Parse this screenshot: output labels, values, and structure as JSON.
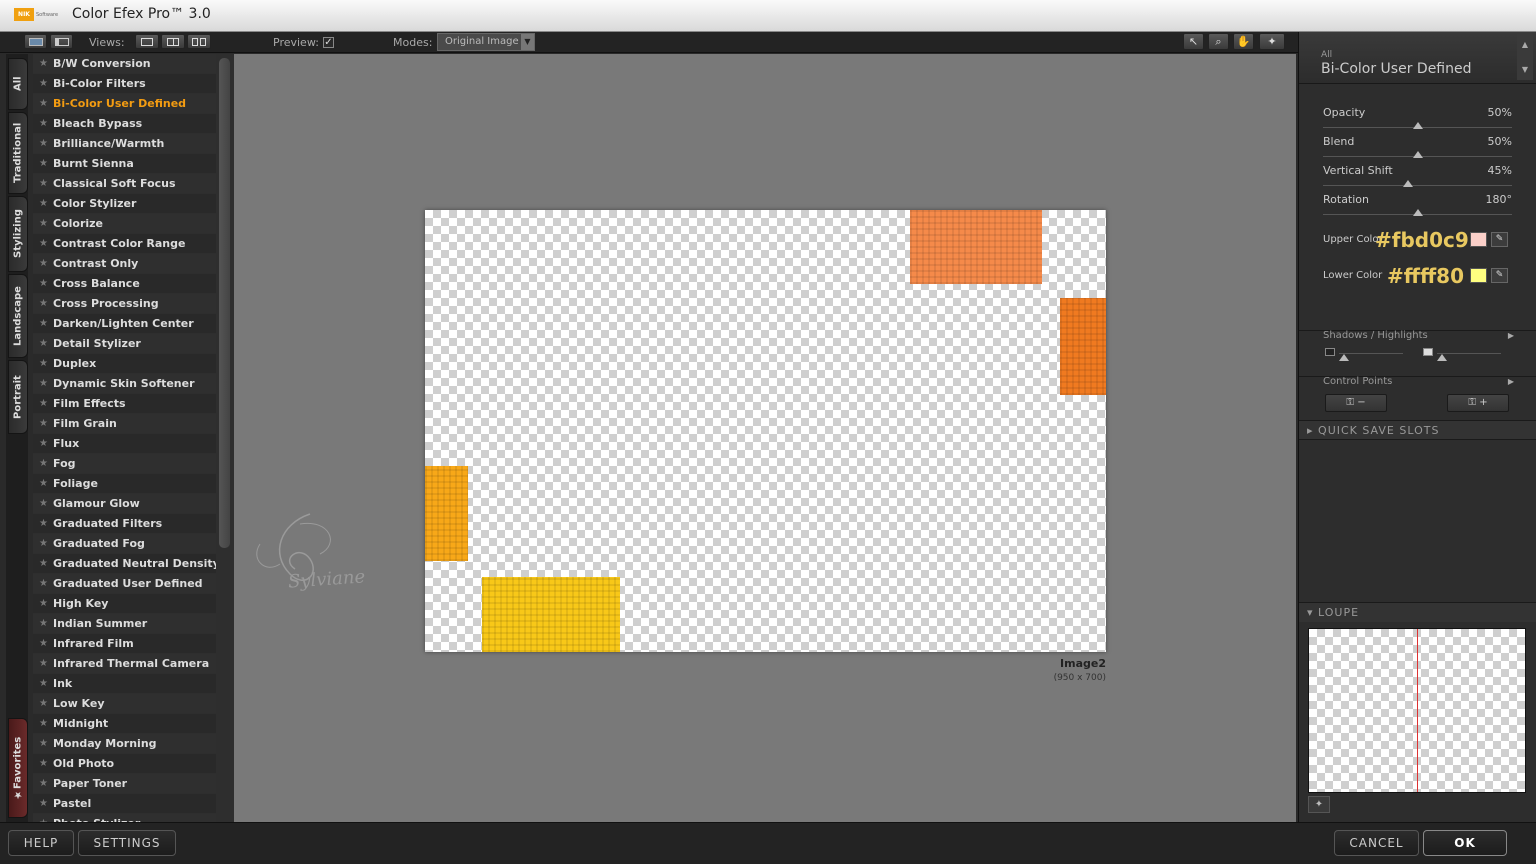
{
  "app": {
    "logo_text": "NIK",
    "logo_sub": "Software",
    "title": "Color Efex Pro™ 3.0"
  },
  "toolbar": {
    "views_label": "Views:",
    "preview_label": "Preview:",
    "preview_checked": true,
    "modes_label": "Modes:",
    "modes_value": "Original Image"
  },
  "side_tabs": [
    "All",
    "Traditional",
    "Stylizing",
    "Landscape",
    "Portrait",
    "Favorites"
  ],
  "filters": [
    "B/W Conversion",
    "Bi-Color Filters",
    "Bi-Color User Defined",
    "Bleach Bypass",
    "Brilliance/Warmth",
    "Burnt Sienna",
    "Classical Soft Focus",
    "Color Stylizer",
    "Colorize",
    "Contrast Color Range",
    "Contrast Only",
    "Cross Balance",
    "Cross Processing",
    "Darken/Lighten Center",
    "Detail Stylizer",
    "Duplex",
    "Dynamic Skin Softener",
    "Film Effects",
    "Film Grain",
    "Flux",
    "Fog",
    "Foliage",
    "Glamour Glow",
    "Graduated Filters",
    "Graduated Fog",
    "Graduated Neutral Density",
    "Graduated User Defined",
    "High Key",
    "Indian Summer",
    "Infrared Film",
    "Infrared Thermal Camera",
    "Ink",
    "Low Key",
    "Midnight",
    "Monday Morning",
    "Old Photo",
    "Paper Toner",
    "Pastel",
    "Photo Stylizer"
  ],
  "selected_filter": "Bi-Color User Defined",
  "image": {
    "name": "Image2",
    "size": "(950 x 700)"
  },
  "watermark_text": "Sylviane",
  "panel": {
    "category": "All",
    "filter_name": "Bi-Color User Defined",
    "sliders": [
      {
        "label": "Opacity",
        "value": "50%",
        "level": 0.5
      },
      {
        "label": "Blend",
        "value": "50%",
        "level": 0.5
      },
      {
        "label": "Vertical Shift",
        "value": "45%",
        "level": 0.45
      },
      {
        "label": "Rotation",
        "value": "180°",
        "level": 0.5
      }
    ],
    "upper_color_label": "Upper Color",
    "upper_color_hex": "#fbd0c9",
    "lower_color_label": "Lower Color",
    "lower_color_hex": "#ffff80",
    "shadows_highlights": "Shadows / Highlights",
    "control_points": "Control Points",
    "quick_save": "QUICK SAVE SLOTS",
    "loupe": "LOUPE"
  },
  "buttons": {
    "help": "HELP",
    "settings": "SETTINGS",
    "cancel": "CANCEL",
    "ok": "OK"
  }
}
